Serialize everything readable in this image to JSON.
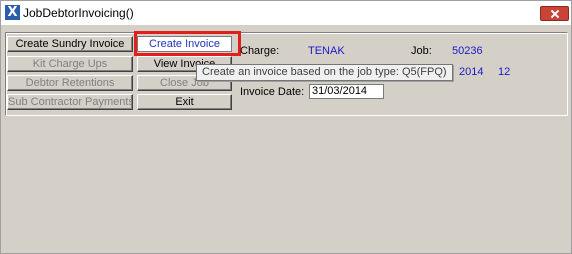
{
  "window": {
    "title": "JobDebtorInvoicing()",
    "app_icon_glyph": "X"
  },
  "buttons": {
    "create_sundry_invoice": "Create Sundry Invoice",
    "create_invoice": "Create Invoice",
    "kit_charge_ups": "Kit Charge Ups",
    "view_invoice": "View Invoice",
    "debtor_retentions": "Debtor Retentions",
    "close_job": "Close Job",
    "sub_contractor_payments": "Sub Contractor Payments",
    "exit": "Exit"
  },
  "fields": {
    "charge_label": "Charge:",
    "charge_value": "TENAK",
    "job_label": "Job:",
    "job_value": "50236",
    "year_value": "2014",
    "period_value": "12",
    "invoice_date_label": "Invoice Date:",
    "invoice_date_value": "31/03/2014"
  },
  "tooltip": {
    "text": "Create an invoice based on the job type: Q5(FPQ)"
  },
  "colors": {
    "highlight": "#e21e1e",
    "value_text": "#1a1acc",
    "focused_button_text": "#2233bb",
    "close_button": "#c94437"
  },
  "icons": [
    "app-icon",
    "close-icon"
  ]
}
